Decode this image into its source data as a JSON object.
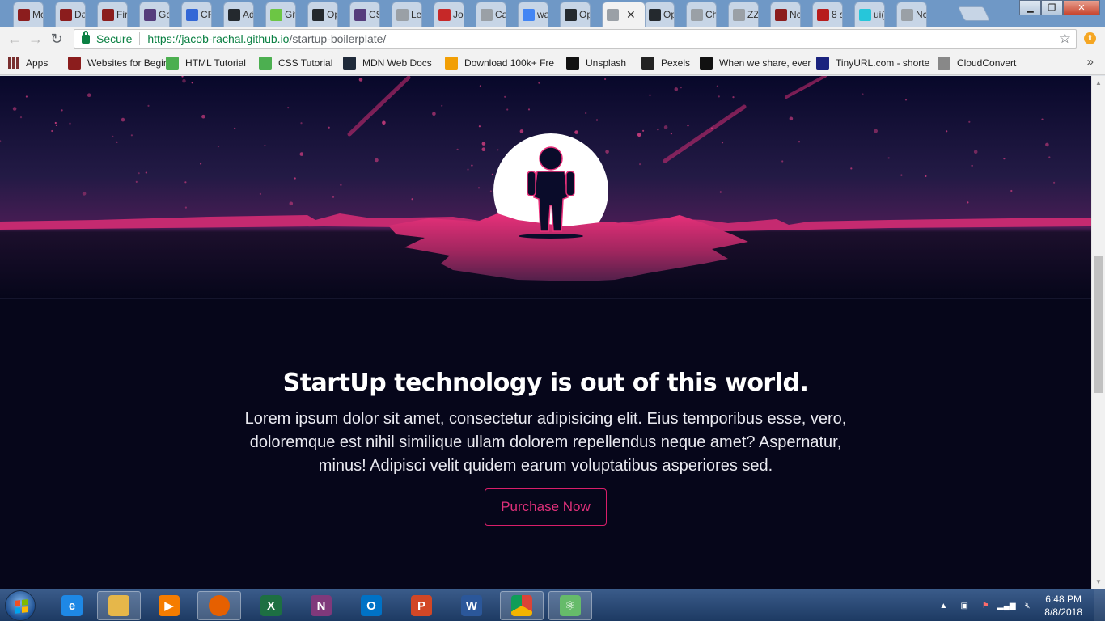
{
  "tabs": [
    {
      "label": "Mc",
      "icon": "app-icon",
      "color": "#8b1d1d"
    },
    {
      "label": "Da",
      "icon": "app-icon",
      "color": "#8b1d1d"
    },
    {
      "label": "Fir",
      "icon": "app-icon",
      "color": "#8b1d1d"
    },
    {
      "label": "Ge",
      "icon": "bootstrap-icon",
      "color": "#563d7c"
    },
    {
      "label": "CR",
      "icon": "app-icon",
      "color": "#3367d6"
    },
    {
      "label": "Ad",
      "icon": "github-icon",
      "color": "#24292e"
    },
    {
      "label": "Git",
      "icon": "github-icon",
      "color": "#6cc644"
    },
    {
      "label": "Op",
      "icon": "github-icon",
      "color": "#24292e"
    },
    {
      "label": "CS",
      "icon": "bootstrap-icon",
      "color": "#563d7c"
    },
    {
      "label": "Le",
      "icon": "page-icon",
      "color": "#9aa0a6"
    },
    {
      "label": "Jol",
      "icon": "app-icon",
      "color": "#c62828"
    },
    {
      "label": "Ca",
      "icon": "page-icon",
      "color": "#9aa0a6"
    },
    {
      "label": "wa",
      "icon": "google-icon",
      "color": "#4285f4"
    },
    {
      "label": "Op",
      "icon": "github-icon",
      "color": "#24292e"
    },
    {
      "label": "",
      "icon": "page-icon",
      "color": "#9aa0a6"
    },
    {
      "label": "Op",
      "icon": "github-icon",
      "color": "#24292e"
    },
    {
      "label": "Ch",
      "icon": "page-icon",
      "color": "#9aa0a6"
    },
    {
      "label": "ZZ",
      "icon": "page-icon",
      "color": "#9aa0a6"
    },
    {
      "label": "Nc",
      "icon": "app-icon",
      "color": "#8b1d1d"
    },
    {
      "label": "8 s",
      "icon": "app-icon",
      "color": "#b71c1c"
    },
    {
      "label": "ui(",
      "icon": "app-icon",
      "color": "#26c6da"
    },
    {
      "label": "Nc",
      "icon": "page-icon",
      "color": "#9aa0a6"
    }
  ],
  "toolbar": {
    "secure_label": "Secure",
    "url_main": "https://jacob-rachal.github.io",
    "url_path": "/startup-boilerplate/"
  },
  "bookmarks": [
    {
      "label": "Apps",
      "icon": "apps-grid-icon"
    },
    {
      "label": "Websites for Beginne",
      "icon": "app-icon",
      "color": "#8b1d1d"
    },
    {
      "label": "HTML Tutorial",
      "icon": "w3-icon",
      "color": "#4caf50"
    },
    {
      "label": "CSS Tutorial",
      "icon": "w3-icon",
      "color": "#4caf50"
    },
    {
      "label": "MDN Web Docs",
      "icon": "mdn-icon",
      "color": "#1f2a3a"
    },
    {
      "label": "Download 100k+ Fre",
      "icon": "vecteezy-icon",
      "color": "#f29f05"
    },
    {
      "label": "Unsplash",
      "icon": "camera-icon",
      "color": "#111"
    },
    {
      "label": "Pexels",
      "icon": "camera-icon",
      "color": "#222"
    },
    {
      "label": "When we share, ever",
      "icon": "cc-icon",
      "color": "#111"
    },
    {
      "label": "TinyURL.com - shorte",
      "icon": "tinyurl-icon",
      "color": "#1a237e"
    },
    {
      "label": "CloudConvert",
      "icon": "cloud-icon",
      "color": "#888"
    }
  ],
  "page": {
    "headline": "StartUp technology is out of this world.",
    "lead": "Lorem ipsum dolor sit amet, consectetur adipisicing elit. Eius temporibus esse, vero, doloremque est nihil similique ullam dolorem repellendus neque amet? Aspernatur, minus! Adipisci velit quidem earum voluptatibus asperiores sed.",
    "cta_label": "Purchase Now",
    "accent_color": "#e0307a",
    "background_color": "#06061a"
  },
  "taskbar": {
    "apps": [
      {
        "name": "internet-explorer-icon",
        "glyph": "e",
        "color": "#1e88e5"
      },
      {
        "name": "file-explorer-icon",
        "glyph": "",
        "color": "#e6b74a"
      },
      {
        "name": "media-player-icon",
        "glyph": "▶",
        "color": "#f57c00"
      },
      {
        "name": "firefox-icon",
        "glyph": "",
        "color": "#e66000"
      },
      {
        "name": "excel-icon",
        "glyph": "X",
        "color": "#1d6f42"
      },
      {
        "name": "onenote-icon",
        "glyph": "N",
        "color": "#80397b"
      },
      {
        "name": "outlook-icon",
        "glyph": "O",
        "color": "#0072c6"
      },
      {
        "name": "powerpoint-icon",
        "glyph": "P",
        "color": "#d24726"
      },
      {
        "name": "word-icon",
        "glyph": "W",
        "color": "#2b579a"
      },
      {
        "name": "chrome-icon",
        "glyph": "",
        "color": "#4caf50"
      },
      {
        "name": "atom-icon",
        "glyph": "⚛",
        "color": "#66bb6a"
      }
    ],
    "time": "6:48 PM",
    "date": "8/8/2018"
  }
}
